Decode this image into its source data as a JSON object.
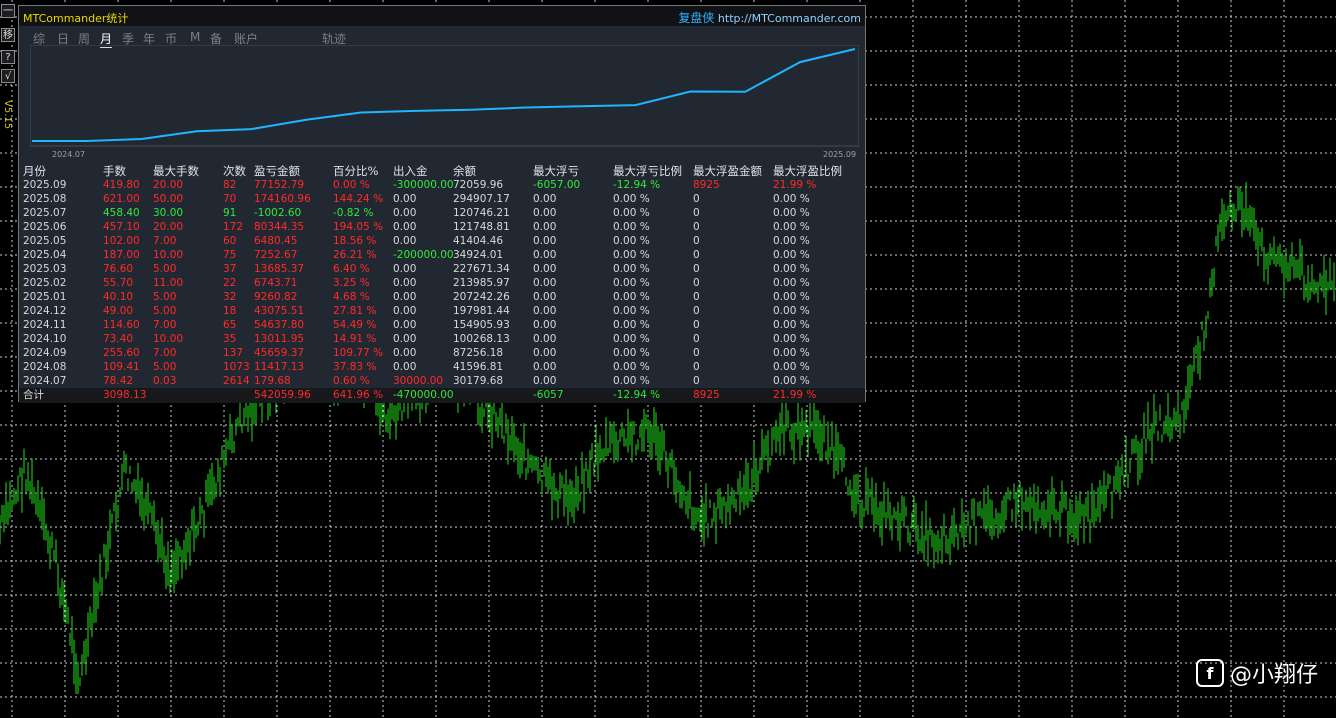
{
  "left_toolbar": {
    "buttons": [
      "一",
      "移",
      "?",
      "√"
    ],
    "version": "V5.15"
  },
  "window": {
    "title": "MTCommander统计",
    "brand_cn": "复盘侠",
    "brand_url": "http://MTCommander.com"
  },
  "tabs": [
    "综",
    "日",
    "周",
    "月",
    "季",
    "年",
    "币",
    "M",
    "备",
    "账户",
    "轨迹"
  ],
  "active_tab": "月",
  "equity_curve": {
    "start_label": "2024.07",
    "end_label": "2025.09",
    "line_color": "#1fb5ff"
  },
  "table": {
    "headers": [
      "月份",
      "手数",
      "最大手数",
      "次数",
      "盈亏金额",
      "百分比%",
      "出入金",
      "余额",
      "最大浮亏",
      "最大浮亏比例",
      "最大浮盈金额",
      "最大浮盈比例"
    ],
    "rows": [
      [
        "2025.09",
        "419.80",
        "20.00",
        "82",
        "77152.79",
        "0.00 %",
        "-300000.00",
        "72059.96",
        "-6057.00",
        "-12.94 %",
        "8925",
        "21.99 %"
      ],
      [
        "2025.08",
        "621.00",
        "50.00",
        "70",
        "174160.96",
        "144.24 %",
        "0.00",
        "294907.17",
        "0.00",
        "0.00 %",
        "0",
        "0.00 %"
      ],
      [
        "2025.07",
        "458.40",
        "30.00",
        "91",
        "-1002.60",
        "-0.82 %",
        "0.00",
        "120746.21",
        "0.00",
        "0.00 %",
        "0",
        "0.00 %"
      ],
      [
        "2025.06",
        "457.10",
        "20.00",
        "172",
        "80344.35",
        "194.05 %",
        "0.00",
        "121748.81",
        "0.00",
        "0.00 %",
        "0",
        "0.00 %"
      ],
      [
        "2025.05",
        "102.00",
        "7.00",
        "60",
        "6480.45",
        "18.56 %",
        "0.00",
        "41404.46",
        "0.00",
        "0.00 %",
        "0",
        "0.00 %"
      ],
      [
        "2025.04",
        "187.00",
        "10.00",
        "75",
        "7252.67",
        "26.21 %",
        "-200000.00",
        "34924.01",
        "0.00",
        "0.00 %",
        "0",
        "0.00 %"
      ],
      [
        "2025.03",
        "76.60",
        "5.00",
        "37",
        "13685.37",
        "6.40 %",
        "0.00",
        "227671.34",
        "0.00",
        "0.00 %",
        "0",
        "0.00 %"
      ],
      [
        "2025.02",
        "55.70",
        "11.00",
        "22",
        "6743.71",
        "3.25 %",
        "0.00",
        "213985.97",
        "0.00",
        "0.00 %",
        "0",
        "0.00 %"
      ],
      [
        "2025.01",
        "40.10",
        "5.00",
        "32",
        "9260.82",
        "4.68 %",
        "0.00",
        "207242.26",
        "0.00",
        "0.00 %",
        "0",
        "0.00 %"
      ],
      [
        "2024.12",
        "49.00",
        "5.00",
        "18",
        "43075.51",
        "27.81 %",
        "0.00",
        "197981.44",
        "0.00",
        "0.00 %",
        "0",
        "0.00 %"
      ],
      [
        "2024.11",
        "114.60",
        "7.00",
        "65",
        "54637.80",
        "54.49 %",
        "0.00",
        "154905.93",
        "0.00",
        "0.00 %",
        "0",
        "0.00 %"
      ],
      [
        "2024.10",
        "73.40",
        "10.00",
        "35",
        "13011.95",
        "14.91 %",
        "0.00",
        "100268.13",
        "0.00",
        "0.00 %",
        "0",
        "0.00 %"
      ],
      [
        "2024.09",
        "255.60",
        "7.00",
        "137",
        "45659.37",
        "109.77 %",
        "0.00",
        "87256.18",
        "0.00",
        "0.00 %",
        "0",
        "0.00 %"
      ],
      [
        "2024.08",
        "109.41",
        "5.00",
        "1073",
        "11417.13",
        "37.83 %",
        "0.00",
        "41596.81",
        "0.00",
        "0.00 %",
        "0",
        "0.00 %"
      ],
      [
        "2024.07",
        "78.42",
        "0.03",
        "2614",
        "179.68",
        "0.60 %",
        "30000.00",
        "30179.68",
        "0.00",
        "0.00 %",
        "0",
        "0.00 %"
      ]
    ],
    "total": {
      "label": "合计",
      "lots": "3098.13",
      "pnl": "542059.96",
      "pct": "641.96 %",
      "flow": "-470000.00",
      "max_float_loss": "-6057",
      "max_float_loss_pct": "-12.94 %",
      "max_float_profit": "8925",
      "max_float_profit_pct": "21.99 %"
    }
  },
  "watermark": {
    "icon": "f",
    "text": "@小翔仔"
  },
  "colors": {
    "profit": "#ff2a2a",
    "loss": "#30e83a",
    "neutral": "#d8d8d8",
    "background": "#000000",
    "grid": "#ffffff",
    "candles": "#22e11d"
  }
}
